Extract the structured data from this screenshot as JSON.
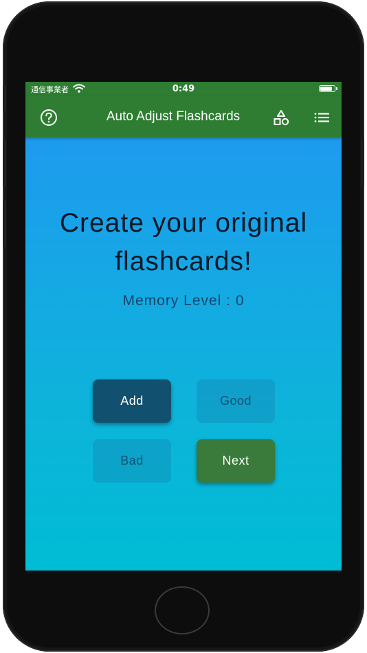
{
  "status_bar": {
    "carrier": "通信事業者",
    "time": "0:49",
    "battery_level": 0.9
  },
  "app_bar": {
    "title": "Auto Adjust Flashcards",
    "icons": {
      "left": "help-circle-icon",
      "right_1": "shapes-icon",
      "right_2": "list-icon"
    }
  },
  "main": {
    "headline": "Create your original flashcards!",
    "memory_level": "Memory Level : 0"
  },
  "buttons": {
    "add": "Add",
    "good": "Good",
    "bad": "Bad",
    "next": "Next"
  },
  "colors": {
    "app_bar": "#2e7d32",
    "gradient_top": "#2196f3",
    "gradient_bottom": "#00bcd4",
    "add_button": "#12506f",
    "next_button": "#3a7a3a"
  }
}
